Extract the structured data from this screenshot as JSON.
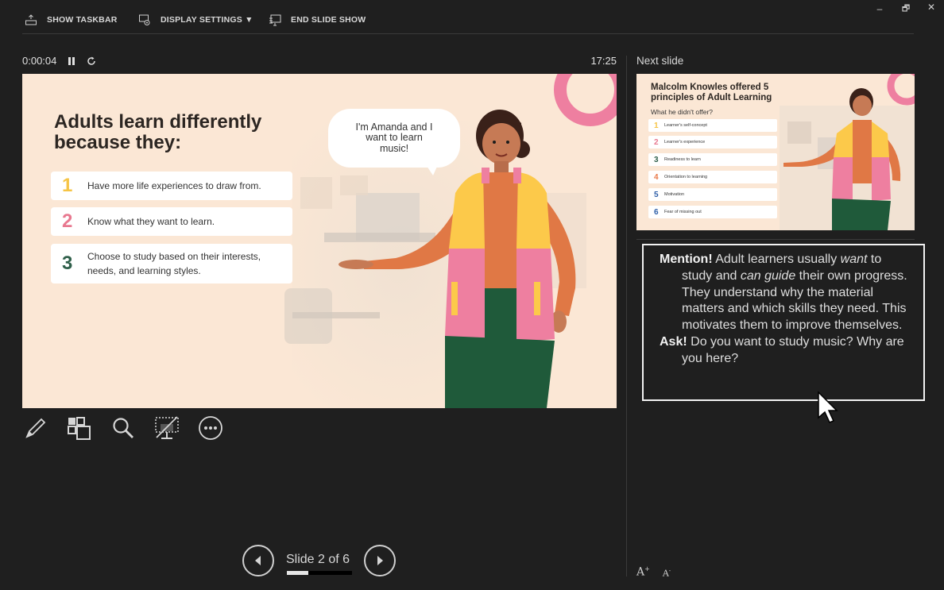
{
  "toolbar": {
    "show_taskbar": "SHOW TASKBAR",
    "display_settings": "DISPLAY SETTINGS ▼",
    "end_slide_show": "END SLIDE SHOW"
  },
  "window_controls": {
    "minimize": "–",
    "restore": "🗗",
    "close": "✕"
  },
  "timer": {
    "elapsed": "0:00:04",
    "clock": "17:25"
  },
  "next_slide_label": "Next slide",
  "current_slide": {
    "title": "Adults learn differently because they:",
    "speech_bubble": "I'm Amanda and I want to learn music!",
    "points": [
      {
        "num": "1",
        "text": "Have more life experiences to draw from.",
        "color": "#f6c445"
      },
      {
        "num": "2",
        "text": "Know what they want to learn.",
        "color": "#e8788f"
      },
      {
        "num": "3",
        "text": "Choose to study based on their interests, needs, and learning styles.",
        "color": "#2f5f4a"
      }
    ]
  },
  "next_slide": {
    "title": "Malcolm Knowles offered 5 principles of Adult Learning",
    "subtitle": "What he didn't offer?",
    "items": [
      {
        "num": "1",
        "text": "Learner's self-concept",
        "color": "#f6c445"
      },
      {
        "num": "2",
        "text": "Learner's experience",
        "color": "#e8788f"
      },
      {
        "num": "3",
        "text": "Readiness to learn",
        "color": "#2f5f4a"
      },
      {
        "num": "4",
        "text": "Orientation to learning",
        "color": "#e97a4a"
      },
      {
        "num": "5",
        "text": "Motivation",
        "color": "#2e5fa8"
      },
      {
        "num": "6",
        "text": "Fear of missing out",
        "color": "#2e5fa8"
      }
    ]
  },
  "notes": {
    "mention_label": "Mention!",
    "mention_1": " Adult learners usually ",
    "mention_em1": "want",
    "mention_2": " to study and ",
    "mention_em2": "can guide",
    "mention_3": " their own progress. They understand why the material matters and which skills they need. This motivates them to improve themselves.",
    "ask_label": "Ask!",
    "ask_text": " Do you want to study music? Why are you here?"
  },
  "navigation": {
    "slide_counter": "Slide 2 of 6",
    "progress": 0.33
  },
  "colors": {
    "accent_pink": "#ee7fa0",
    "background": "#1f1f1f"
  }
}
